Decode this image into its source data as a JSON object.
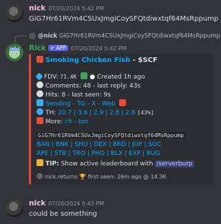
{
  "messages": {
    "first": {
      "username": "nick",
      "timestamp": "07/20/2024 5:42 PM",
      "content": "GiG7Hr61RVm4CSUxJmgiCoySFQtdiwxtqf64MsRppump"
    },
    "bot": {
      "reply_username": "@nick",
      "reply_content": "GiG7Hr61RVm4CSUxJmgiCoySFQtdiwxtqf64MsRppump",
      "username": "Rick",
      "badge": "APP",
      "timestamp": "07/20/2024 5:42 PM",
      "embed": {
        "accent_color": "#e74c3c",
        "title_link": "Smoking Chicken Fish",
        "title_sep": " - ",
        "title_ticker": "$SCF",
        "fdv_label": "FDV: ",
        "fdv_value": "71.4K",
        "created": "Created 1h ago",
        "comments": "Comments: 48 - last reply: 43s",
        "hits": "Hits: 8 - last seen: 9s",
        "sending_prefix": "Sending",
        "sending_links": " - TG - X - Web",
        "th_label": "TH:",
        "th_values": "20.7 | 3.6 | 2.9 | 2.8 | 2.8",
        "th_total": "[43%]",
        "more_label": "More:",
        "more_links": "ch - bm",
        "address": "GiG7Hr61RVm4CSUxJmgiCoySFQtdiwxtqf64MsRppump",
        "links_row1": "BAN | BNK | SHU | DEX | BRD | JUP | SOC",
        "links_row2": "APE | STB | TRO | PHO | BLX | EXP | RUG",
        "tip_label": "TIP:",
        "tip_text": "Show active leaderboard with",
        "tip_command": "/serverburp",
        "footer_user": "nick.returns",
        "footer_text": "first seen: 26m ago @ 14.3K"
      }
    },
    "last": {
      "username": "nick",
      "timestamp": "07/20/2024 5:43 PM",
      "content": "could be something"
    }
  }
}
